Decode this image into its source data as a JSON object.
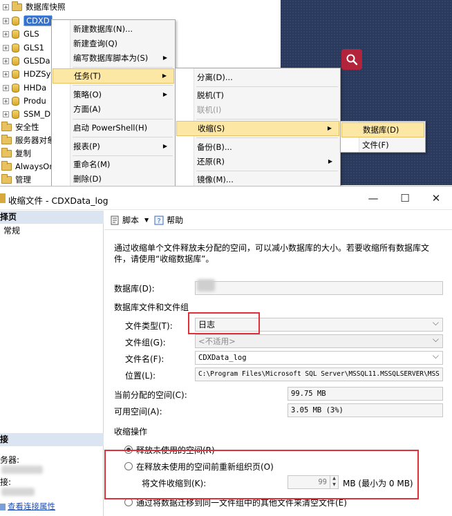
{
  "tree": {
    "items": [
      "数据库快照",
      "CDXD",
      "GLS",
      "GLS1",
      "GLSDa",
      "HDZSy",
      "HHDa",
      "Produ",
      "SSM_D",
      "安全性",
      "服务器对象",
      "复制",
      "AlwaysOn",
      "管理"
    ]
  },
  "context_menu_1": {
    "items": [
      "新建数据库(N)...",
      "新建查询(Q)",
      "编写数据库脚本为(S)",
      "任务(T)",
      "策略(O)",
      "方面(A)",
      "启动 PowerShell(H)",
      "报表(P)",
      "重命名(M)",
      "删除(D)"
    ]
  },
  "context_menu_2": {
    "items": [
      "分离(D)...",
      "脱机(T)",
      "联机(I)",
      "收缩(S)",
      "备份(B)...",
      "还原(R)",
      "镜像(M)..."
    ]
  },
  "context_menu_3": {
    "items": [
      "数据库(D)",
      "文件(F)"
    ]
  },
  "dialog": {
    "title": "收缩文件 - CDXData_log",
    "min_glyph": "—",
    "max_glyph": "☐",
    "close_glyph": "✕"
  },
  "left_pane": {
    "select_page_header": "择页",
    "general_item": "常规",
    "connection_header": "接",
    "server_label": "务器:",
    "connection_label": "接:",
    "view_props_link": "查看连接属性"
  },
  "toolbar": {
    "script_label": "脚本",
    "help_label": "帮助"
  },
  "form": {
    "description": "通过收缩单个文件释放未分配的空间，可以减小数据库的大小。若要收缩所有数据库文件，请使用“收缩数据库”。",
    "database_label": "数据库(D):",
    "files_group_title": "数据库文件和文件组",
    "file_type_label": "文件类型(T):",
    "file_type_value": "日志",
    "filegroup_label": "文件组(G):",
    "filegroup_value": "<不适用>",
    "filename_label": "文件名(F):",
    "filename_value": "CDXData_log",
    "location_label": "位置(L):",
    "location_value": "C:\\Program Files\\Microsoft SQL Server\\MSSQL11.MSSQLSERVER\\MSS",
    "allocated_label": "当前分配的空间(C):",
    "allocated_value": "99.75 MB",
    "available_label": "可用空间(A):",
    "available_value": "3.05 MB (3%)",
    "shrink_action_title": "收缩操作",
    "option_release": "释放未使用的空间(R)",
    "option_reorganize": "在释放未使用的空间前重新组织页(O)",
    "shrink_to_label": "将文件收缩到(K):",
    "shrink_to_value": "99",
    "shrink_to_unit": "MB (最小为 0 MB)",
    "option_empty": "通过将数据迁移到同一文件组中的其他文件来清空文件(E)"
  },
  "colors": {
    "highlight_red": "#e0313a",
    "menu_highlight": "#fde7a5",
    "navy_background": "#2b3a5c",
    "search_red": "#b3243a"
  }
}
